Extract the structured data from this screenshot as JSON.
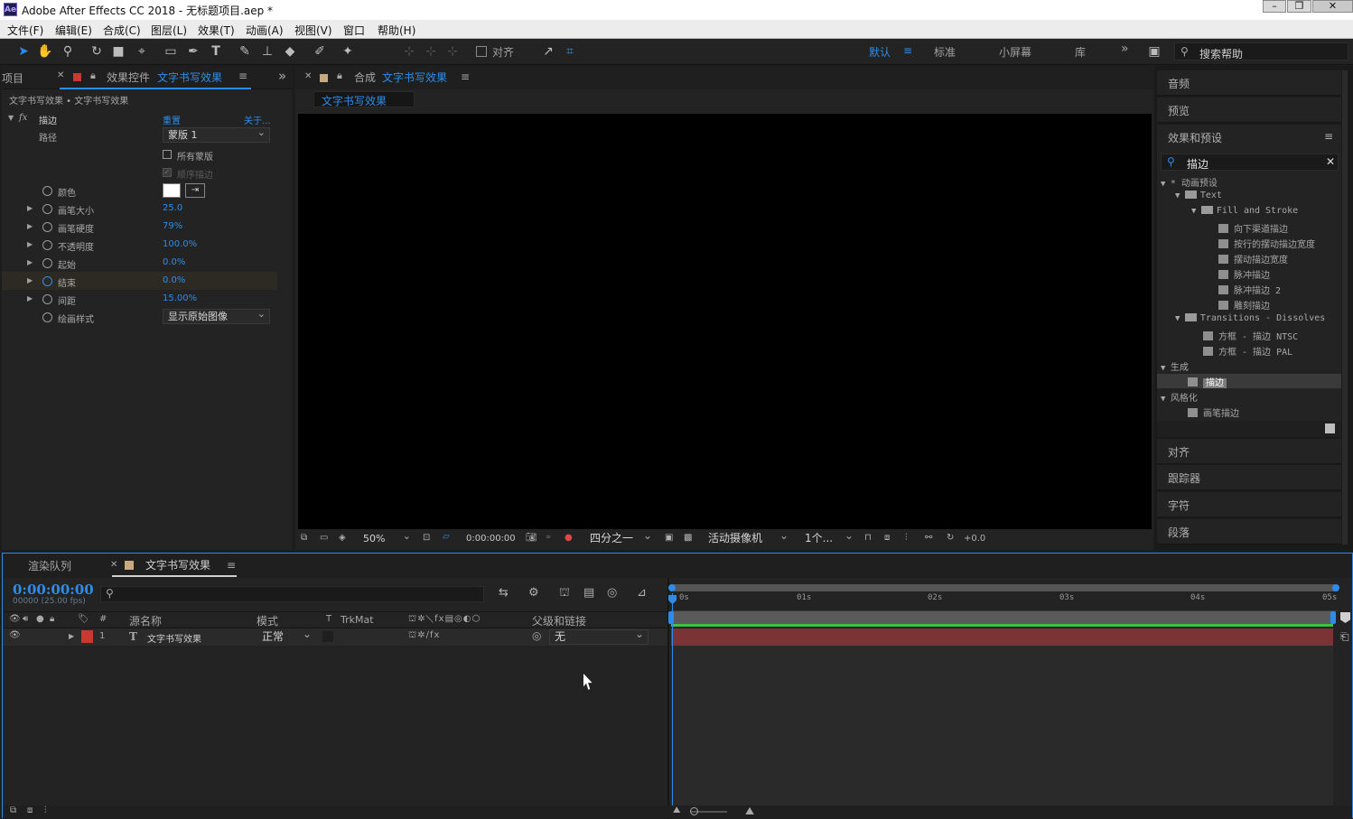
{
  "window": {
    "title": "Adobe After Effects CC 2018 - 无标题项目.aep *",
    "app_icon": "Ae"
  },
  "menu": [
    "文件(F)",
    "编辑(E)",
    "合成(C)",
    "图层(L)",
    "效果(T)",
    "动画(A)",
    "视图(V)",
    "窗口",
    "帮助(H)"
  ],
  "toolbar": {
    "align_label": "对齐",
    "workspaces": [
      "默认",
      "标准",
      "小屏幕",
      "库"
    ],
    "search_placeholder": "搜索帮助"
  },
  "left_panel": {
    "project_tab": "项目",
    "tab_prefix": "效果控件",
    "tab_name": "文字书写效果",
    "breadcrumb": "文字书写效果 • 文字书写效果",
    "effect_name": "描边",
    "reset": "重置",
    "about": "关于...",
    "path_label": "路径",
    "path_value": "蒙版 1",
    "all_masks": "所有蒙版",
    "sequential": "顺序描边",
    "color_label": "颜色",
    "props": [
      {
        "label": "画笔大小",
        "value": "25.0"
      },
      {
        "label": "画笔硬度",
        "value": "79%"
      },
      {
        "label": "不透明度",
        "value": "100.0%"
      },
      {
        "label": "起始",
        "value": "0.0%"
      },
      {
        "label": "结束",
        "value": "0.0%"
      },
      {
        "label": "间距",
        "value": "15.00%"
      }
    ],
    "paint_style_label": "绘画样式",
    "paint_style_value": "显示原始图像"
  },
  "comp_panel": {
    "tab_prefix": "合成",
    "tab_name": "文字书写效果",
    "subtab": "文字书写效果",
    "zoom": "50%",
    "timecode": "0:00:00:00",
    "resolution": "四分之一",
    "camera": "活动摄像机",
    "views": "1个...",
    "exposure": "+0.0"
  },
  "right_panel": {
    "sections_top": [
      "音频",
      "预览"
    ],
    "effects_title": "效果和预设",
    "search_value": "描边",
    "sections_bottom": [
      "对齐",
      "跟踪器",
      "字符",
      "段落"
    ],
    "tree": {
      "animation_presets": "* 动画预设",
      "text": "Text",
      "fill_stroke": "Fill and Stroke",
      "presets": [
        "向下渠道描边",
        "按行的摆动描边宽度",
        "摆动描边宽度",
        "脉冲描边",
        "脉冲描边 2",
        "雕刻描边"
      ],
      "transitions": "Transitions - Dissolves",
      "transition_presets": [
        "方框 - 描边 NTSC",
        "方框 - 描边 PAL"
      ],
      "generate": "生成",
      "generate_item": "描边",
      "stylize": "风格化",
      "stylize_item": "画笔描边"
    }
  },
  "timeline": {
    "render_queue_tab": "渲染队列",
    "comp_tab": "文字书写效果",
    "timecode": "0:00:00:00",
    "fps": "00000 (25.00 fps)",
    "col_source": "源名称",
    "col_mode": "模式",
    "col_t": "T",
    "col_trkmat": "TrkMat",
    "col_parent": "父级和链接",
    "ruler": [
      "0s",
      "01s",
      "02s",
      "03s",
      "04s",
      "05s"
    ],
    "layer": {
      "index": "1",
      "type": "T",
      "name": "文字书写效果",
      "mode": "正常",
      "parent": "无"
    },
    "colors": {
      "layer_label": "#c83a31",
      "layer_bar": "#7a3436",
      "work_area": "#3ec13e",
      "accent": "#2d8ceb"
    }
  }
}
